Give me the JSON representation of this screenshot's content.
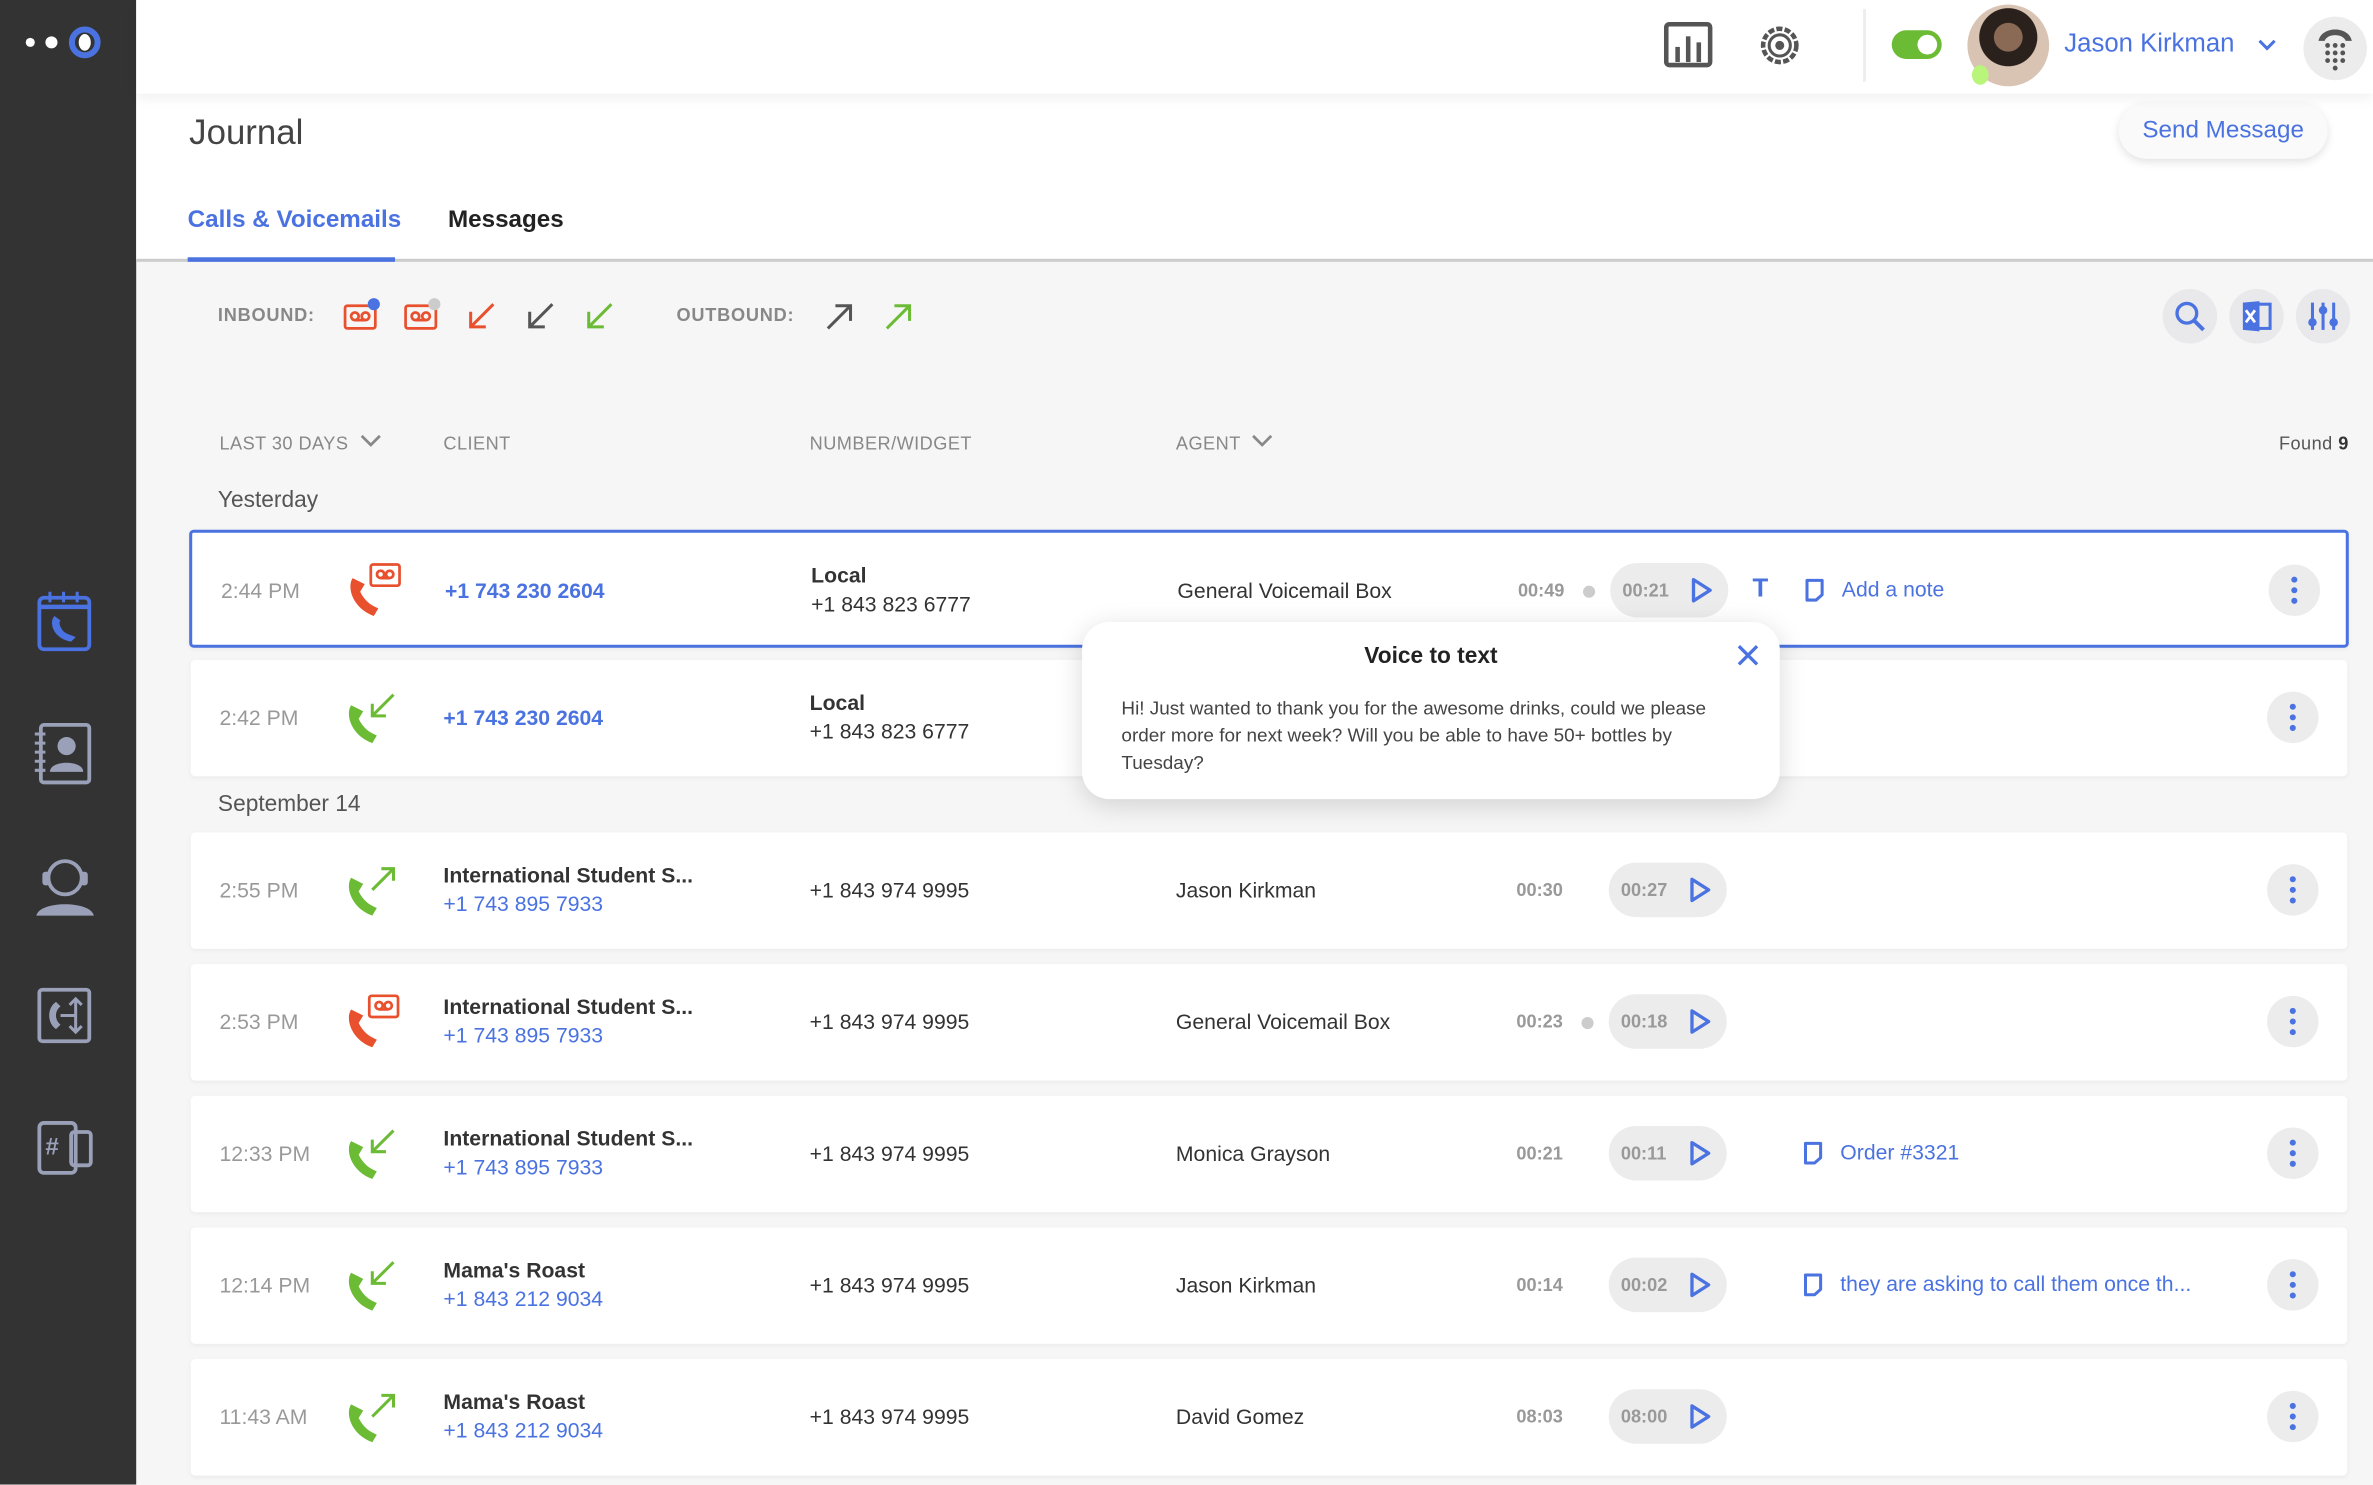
{
  "colors": {
    "accent": "#4a72e0",
    "missed": "#e8502e",
    "answered": "#6cbb35",
    "sidebar": "#333333"
  },
  "topbar": {
    "user_name": "Jason Kirkman",
    "status_toggle_on": true,
    "icons": [
      "reports-icon",
      "settings-icon",
      "status-toggle",
      "avatar",
      "chevron-down-icon",
      "dialpad-icon"
    ]
  },
  "sidebar": {
    "items": [
      {
        "icon": "call-journal-icon",
        "active": true
      },
      {
        "icon": "contacts-icon",
        "active": false
      },
      {
        "icon": "agent-headset-icon",
        "active": false
      },
      {
        "icon": "call-flow-icon",
        "active": false
      },
      {
        "icon": "numbers-icon",
        "active": false
      }
    ]
  },
  "page": {
    "title": "Journal",
    "send_message": "Send Message"
  },
  "tabs": [
    {
      "label": "Calls & Voicemails",
      "active": true
    },
    {
      "label": "Messages",
      "active": false
    }
  ],
  "filters": {
    "inbound_label": "INBOUND:",
    "outbound_label": "OUTBOUND:"
  },
  "columns": {
    "period": "LAST 30 DAYS",
    "client": "CLIENT",
    "number": "NUMBER/WIDGET",
    "agent": "AGENT",
    "found_label": "Found",
    "found_count": "9"
  },
  "groups": [
    "Yesterday",
    "September 14"
  ],
  "rows": [
    {
      "group": 0,
      "selected": true,
      "time": "2:44 PM",
      "type": "voicemail",
      "client_name": "",
      "client_number": "+1 743 230 2604",
      "widget_name": "Local",
      "widget_number": "+1 843 823 6777",
      "agent": "General Voicemail Box",
      "duration": "00:49",
      "dot": true,
      "recording": "00:21",
      "transcript": true,
      "note": "Add a note"
    },
    {
      "group": 0,
      "selected": false,
      "time": "2:42 PM",
      "type": "inbound",
      "client_name": "",
      "client_number": "+1 743 230 2604",
      "widget_name": "Local",
      "widget_number": "+1 843 823 6777",
      "agent": "",
      "duration": "",
      "dot": false,
      "recording": "",
      "transcript": false,
      "note": ""
    },
    {
      "group": 1,
      "selected": false,
      "time": "2:55 PM",
      "type": "outbound",
      "client_name": "International Student S...",
      "client_number": "+1 743 895 7933",
      "widget_name": "",
      "widget_number": "+1 843 974 9995",
      "agent": "Jason Kirkman",
      "duration": "00:30",
      "dot": false,
      "recording": "00:27",
      "transcript": false,
      "note": ""
    },
    {
      "group": 1,
      "selected": false,
      "time": "2:53 PM",
      "type": "voicemail",
      "client_name": "International Student S...",
      "client_number": "+1 743 895 7933",
      "widget_name": "",
      "widget_number": "+1 843 974 9995",
      "agent": "General Voicemail Box",
      "duration": "00:23",
      "dot": true,
      "recording": "00:18",
      "transcript": false,
      "note": ""
    },
    {
      "group": 1,
      "selected": false,
      "time": "12:33 PM",
      "type": "inbound",
      "client_name": "International Student S...",
      "client_number": "+1 743 895 7933",
      "widget_name": "",
      "widget_number": "+1 843 974 9995",
      "agent": "Monica Grayson",
      "duration": "00:21",
      "dot": false,
      "recording": "00:11",
      "transcript": false,
      "note": "Order #3321"
    },
    {
      "group": 1,
      "selected": false,
      "time": "12:14 PM",
      "type": "inbound",
      "client_name": "Mama's Roast",
      "client_number": "+1 843 212 9034",
      "widget_name": "",
      "widget_number": "+1 843 974 9995",
      "agent": "Jason Kirkman",
      "duration": "00:14",
      "dot": false,
      "recording": "00:02",
      "transcript": false,
      "note": "they are asking to call them once th..."
    },
    {
      "group": 1,
      "selected": false,
      "time": "11:43 AM",
      "type": "outbound",
      "client_name": "Mama's Roast",
      "client_number": "+1 843 212 9034",
      "widget_name": "",
      "widget_number": "+1 843 974 9995",
      "agent": "David Gomez",
      "duration": "08:03",
      "dot": false,
      "recording": "08:00",
      "transcript": false,
      "note": ""
    }
  ],
  "popup": {
    "title": "Voice to text",
    "text": "Hi! Just wanted to thank you for the awesome drinks, could we please order more for next week? Will you be able to have 50+ bottles by Tuesday?"
  }
}
